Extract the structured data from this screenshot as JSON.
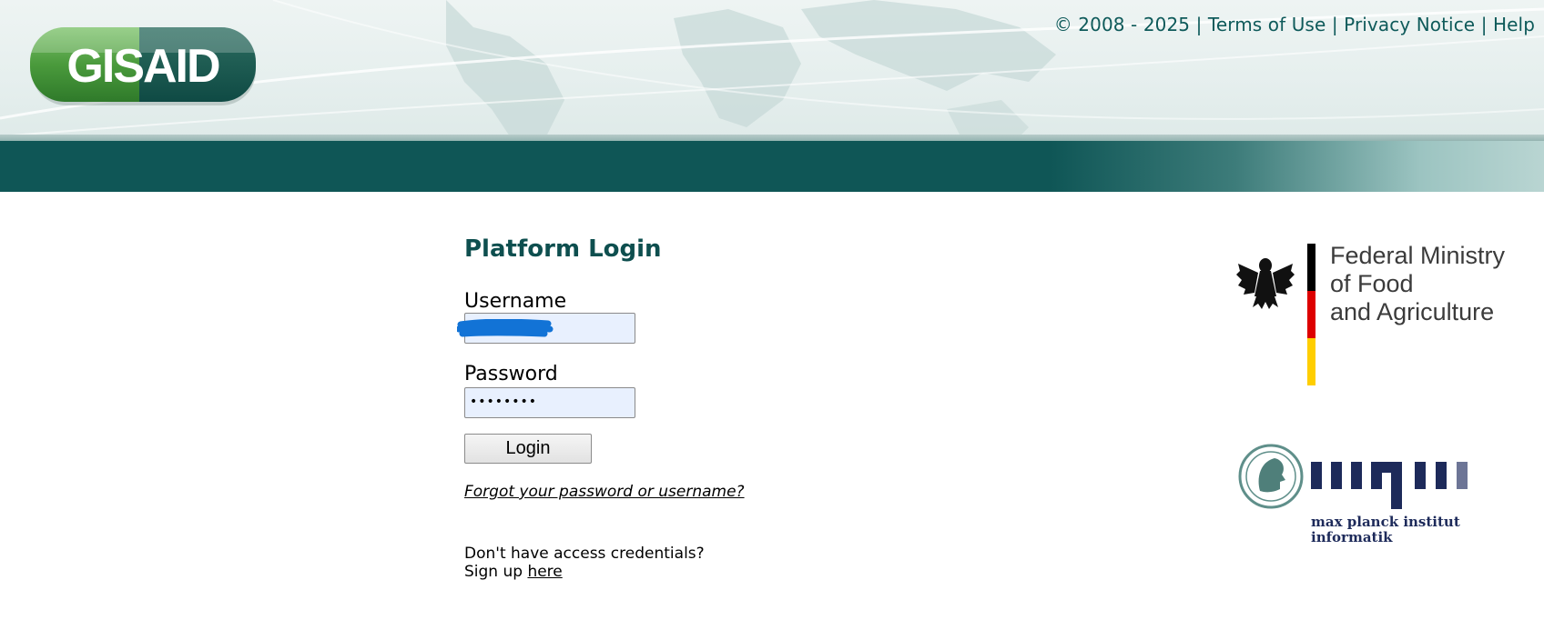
{
  "header": {
    "logo_text": "GISAID",
    "copyright": "© 2008 - 2025",
    "links": [
      "Terms of Use",
      "Privacy Notice",
      "Help"
    ],
    "separator": "|"
  },
  "login": {
    "title": "Platform Login",
    "username_label": "Username",
    "username_value": "",
    "password_label": "Password",
    "password_dots": "••••••••",
    "button_label": "Login",
    "forgot_link": "Forgot your password or username?",
    "no_access_text": "Don't have access credentials?",
    "signup_prefix": "Sign up ",
    "signup_link": "here"
  },
  "partners": {
    "bmel_text": "Federal Ministry\nof Food\nand Agriculture",
    "mpi_logo_text": "mpi",
    "mpi_text": "max planck institut\ninformatik"
  },
  "colors": {
    "brand_teal": "#0e5a5a",
    "logo_green": "#4a9a3c",
    "input_bg": "#e8f0fe",
    "redaction_blue": "#1273d6"
  }
}
